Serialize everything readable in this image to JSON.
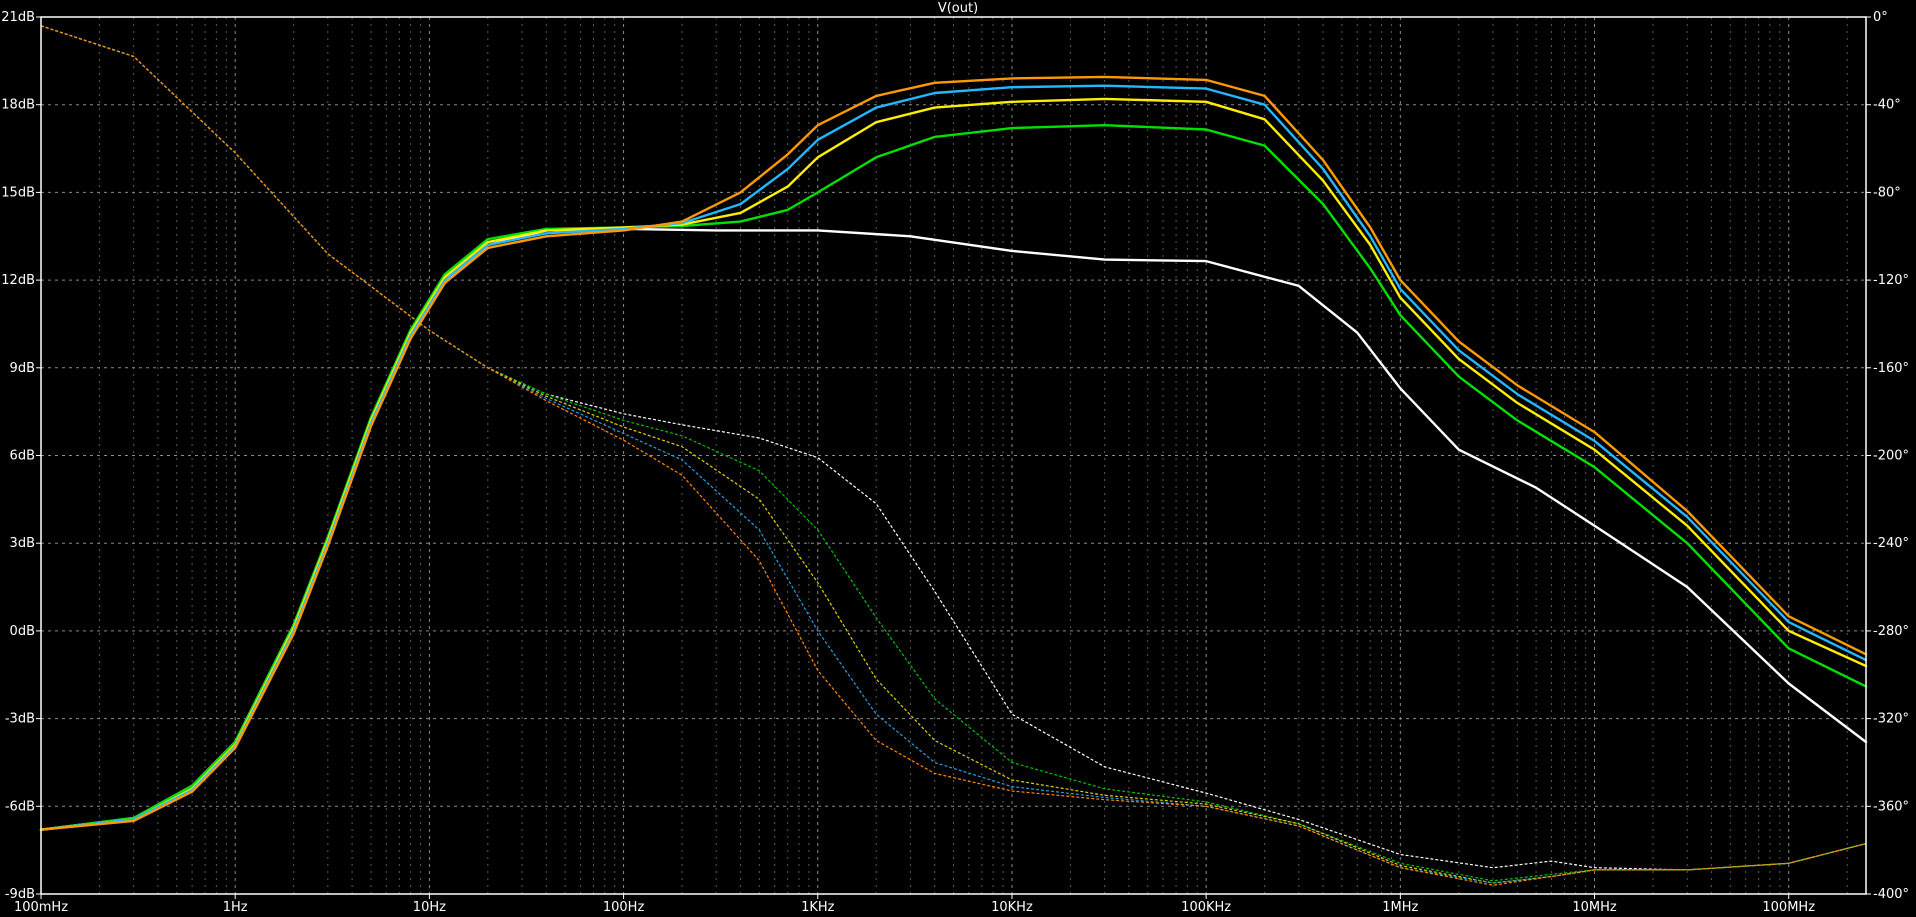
{
  "chart_data": {
    "type": "line",
    "title": "V(out)",
    "x_scale": "log",
    "xlim": [
      0.1,
      250000000
    ],
    "ylim": [
      -9,
      21
    ],
    "y2lim": [
      -400,
      0
    ],
    "x_ticks": [
      {
        "value": 0.1,
        "label": "100mHz"
      },
      {
        "value": 1,
        "label": "1Hz"
      },
      {
        "value": 10,
        "label": "10Hz"
      },
      {
        "value": 100,
        "label": "100Hz"
      },
      {
        "value": 1000,
        "label": "1KHz"
      },
      {
        "value": 10000,
        "label": "10KHz"
      },
      {
        "value": 100000,
        "label": "100KHz"
      },
      {
        "value": 1000000,
        "label": "1MHz"
      },
      {
        "value": 10000000,
        "label": "10MHz"
      },
      {
        "value": 100000000,
        "label": "100MHz"
      }
    ],
    "y_ticks": [
      {
        "value": 21,
        "label": "21dB"
      },
      {
        "value": 18,
        "label": "18dB"
      },
      {
        "value": 15,
        "label": "15dB"
      },
      {
        "value": 12,
        "label": "12dB"
      },
      {
        "value": 9,
        "label": "9dB"
      },
      {
        "value": 6,
        "label": "6dB"
      },
      {
        "value": 3,
        "label": "3dB"
      },
      {
        "value": 0,
        "label": "0dB"
      },
      {
        "value": -3,
        "label": "-3dB"
      },
      {
        "value": -6,
        "label": "-6dB"
      },
      {
        "value": -9,
        "label": "-9dB"
      }
    ],
    "y2_ticks": [
      {
        "value": 0,
        "label": "0°"
      },
      {
        "value": -40,
        "label": "-40°"
      },
      {
        "value": -80,
        "label": "-80°"
      },
      {
        "value": -120,
        "label": "-120°"
      },
      {
        "value": -160,
        "label": "-160°"
      },
      {
        "value": -200,
        "label": "-200°"
      },
      {
        "value": -240,
        "label": "-240°"
      },
      {
        "value": -280,
        "label": "-280°"
      },
      {
        "value": -320,
        "label": "-320°"
      },
      {
        "value": -360,
        "label": "-360°"
      },
      {
        "value": -400,
        "label": "-400°"
      }
    ],
    "grid": true,
    "colors": {
      "background": "#000000",
      "axis": "#ffffff",
      "text": "#ffffff"
    },
    "magnitude_series": [
      {
        "color": "#ffffff",
        "x": [
          0.1,
          0.3,
          0.6,
          1,
          2,
          3,
          5,
          8,
          12,
          20,
          40,
          100,
          300,
          1000,
          3000,
          10000,
          30000,
          100000,
          300000,
          600000,
          1000000,
          2000000,
          5000000,
          10000000,
          30000000,
          100000000,
          250000000
        ],
        "y": [
          -6.8,
          -6.4,
          -5.3,
          -3.8,
          0.2,
          3.2,
          7.2,
          10.1,
          11.9,
          13.2,
          13.7,
          13.75,
          13.7,
          13.7,
          13.5,
          13.0,
          12.7,
          12.65,
          11.8,
          10.2,
          8.3,
          6.2,
          4.9,
          3.6,
          1.5,
          -1.8,
          -3.8
        ]
      },
      {
        "color": "#00e000",
        "x": [
          0.1,
          0.3,
          0.6,
          1,
          2,
          3,
          5,
          8,
          12,
          20,
          40,
          100,
          200,
          400,
          700,
          1000,
          2000,
          4000,
          10000,
          30000,
          100000,
          200000,
          400000,
          700000,
          1000000,
          2000000,
          4000000,
          10000000,
          30000000,
          100000000,
          250000000
        ],
        "y": [
          -6.8,
          -6.4,
          -5.3,
          -3.8,
          0.2,
          3.2,
          7.3,
          10.3,
          12.2,
          13.4,
          13.75,
          13.8,
          13.85,
          14.0,
          14.4,
          15.0,
          16.2,
          16.9,
          17.2,
          17.3,
          17.15,
          16.6,
          14.6,
          12.4,
          10.8,
          8.7,
          7.2,
          5.6,
          3.0,
          -0.6,
          -1.9
        ]
      },
      {
        "color": "#ffee00",
        "x": [
          0.1,
          0.3,
          0.6,
          1,
          2,
          3,
          5,
          8,
          12,
          20,
          40,
          100,
          200,
          400,
          700,
          1000,
          2000,
          4000,
          10000,
          30000,
          100000,
          200000,
          400000,
          700000,
          1000000,
          2000000,
          4000000,
          10000000,
          30000000,
          100000000,
          250000000
        ],
        "y": [
          -6.8,
          -6.45,
          -5.4,
          -3.9,
          0.1,
          3.1,
          7.2,
          10.2,
          12.1,
          13.3,
          13.7,
          13.8,
          13.9,
          14.3,
          15.2,
          16.2,
          17.4,
          17.9,
          18.1,
          18.2,
          18.1,
          17.5,
          15.4,
          13.2,
          11.4,
          9.3,
          7.8,
          6.2,
          3.6,
          0.0,
          -1.2
        ]
      },
      {
        "color": "#22b8ff",
        "x": [
          0.1,
          0.3,
          0.6,
          1,
          2,
          3,
          5,
          8,
          12,
          20,
          40,
          100,
          200,
          400,
          700,
          1000,
          2000,
          4000,
          10000,
          30000,
          100000,
          200000,
          400000,
          700000,
          1000000,
          2000000,
          4000000,
          10000000,
          30000000,
          100000000,
          250000000
        ],
        "y": [
          -6.8,
          -6.45,
          -5.45,
          -3.95,
          0.0,
          3.0,
          7.1,
          10.1,
          12.0,
          13.2,
          13.6,
          13.75,
          13.95,
          14.6,
          15.8,
          16.8,
          17.9,
          18.4,
          18.6,
          18.65,
          18.55,
          18.0,
          15.8,
          13.5,
          11.7,
          9.6,
          8.1,
          6.5,
          3.9,
          0.3,
          -1.0
        ]
      },
      {
        "color": "#ff9900",
        "x": [
          0.1,
          0.3,
          0.6,
          1,
          2,
          3,
          5,
          8,
          12,
          20,
          40,
          100,
          200,
          400,
          700,
          1000,
          2000,
          4000,
          10000,
          30000,
          100000,
          200000,
          400000,
          700000,
          1000000,
          2000000,
          4000000,
          10000000,
          30000000,
          100000000,
          250000000
        ],
        "y": [
          -6.8,
          -6.5,
          -5.5,
          -4.0,
          -0.1,
          2.9,
          7.0,
          10.0,
          11.9,
          13.1,
          13.5,
          13.7,
          14.0,
          15.0,
          16.3,
          17.3,
          18.3,
          18.75,
          18.9,
          18.95,
          18.85,
          18.3,
          16.1,
          13.8,
          12.0,
          9.9,
          8.4,
          6.8,
          4.1,
          0.5,
          -0.8
        ]
      }
    ],
    "phase_series": [
      {
        "color": "#ffffff",
        "x": [
          0.1,
          0.3,
          1,
          3,
          10,
          20,
          40,
          100,
          200,
          500,
          1000,
          2000,
          4000,
          10000,
          30000,
          100000,
          300000,
          1000000,
          3000000,
          6000000,
          10000000,
          30000000,
          100000000,
          250000000
        ],
        "y": [
          -4,
          -18,
          -62,
          -108,
          -143,
          -160,
          -172,
          -181,
          -186,
          -192,
          -201,
          -222,
          -262,
          -318,
          -342,
          -354,
          -366,
          -382,
          -388,
          -385,
          -388,
          -389,
          -386,
          -377
        ]
      },
      {
        "color": "#00c000",
        "x": [
          0.1,
          0.3,
          1,
          3,
          10,
          20,
          40,
          100,
          200,
          500,
          1000,
          2000,
          4000,
          10000,
          30000,
          100000,
          300000,
          1000000,
          3000000,
          6000000,
          10000000,
          30000000,
          100000000,
          250000000
        ],
        "y": [
          -4,
          -18,
          -62,
          -108,
          -143,
          -160,
          -172,
          -184,
          -191,
          -207,
          -234,
          -274,
          -311,
          -340,
          -352,
          -358,
          -368,
          -386,
          -394,
          -391,
          -389,
          -389,
          -386,
          -377
        ]
      },
      {
        "color": "#e0d000",
        "x": [
          0.1,
          0.3,
          1,
          3,
          10,
          20,
          40,
          100,
          200,
          500,
          1000,
          2000,
          4000,
          10000,
          30000,
          100000,
          300000,
          1000000,
          3000000,
          6000000,
          10000000,
          30000000,
          100000000,
          250000000
        ],
        "y": [
          -4,
          -18,
          -62,
          -108,
          -143,
          -160,
          -173,
          -187,
          -196,
          -220,
          -258,
          -302,
          -330,
          -348,
          -355,
          -359,
          -368,
          -387,
          -395,
          -392,
          -389,
          -389,
          -386,
          -377
        ]
      },
      {
        "color": "#20a0e0",
        "x": [
          0.1,
          0.3,
          1,
          3,
          10,
          20,
          40,
          100,
          200,
          500,
          1000,
          2000,
          4000,
          10000,
          30000,
          100000,
          300000,
          1000000,
          3000000,
          6000000,
          10000000,
          30000000,
          100000000,
          250000000
        ],
        "y": [
          -4,
          -18,
          -62,
          -108,
          -143,
          -160,
          -174,
          -190,
          -202,
          -234,
          -280,
          -318,
          -340,
          -351,
          -356,
          -360,
          -369,
          -388,
          -395,
          -392,
          -389,
          -389,
          -386,
          -377
        ]
      },
      {
        "color": "#ff8800",
        "x": [
          0.1,
          0.3,
          1,
          3,
          10,
          20,
          40,
          100,
          200,
          500,
          1000,
          2000,
          4000,
          10000,
          30000,
          100000,
          300000,
          1000000,
          3000000,
          6000000,
          10000000,
          30000000,
          100000000,
          250000000
        ],
        "y": [
          -4,
          -18,
          -62,
          -108,
          -143,
          -160,
          -175,
          -193,
          -209,
          -248,
          -298,
          -330,
          -345,
          -353,
          -357,
          -360,
          -369,
          -388,
          -396,
          -392,
          -389,
          -389,
          -386,
          -377
        ]
      }
    ]
  }
}
